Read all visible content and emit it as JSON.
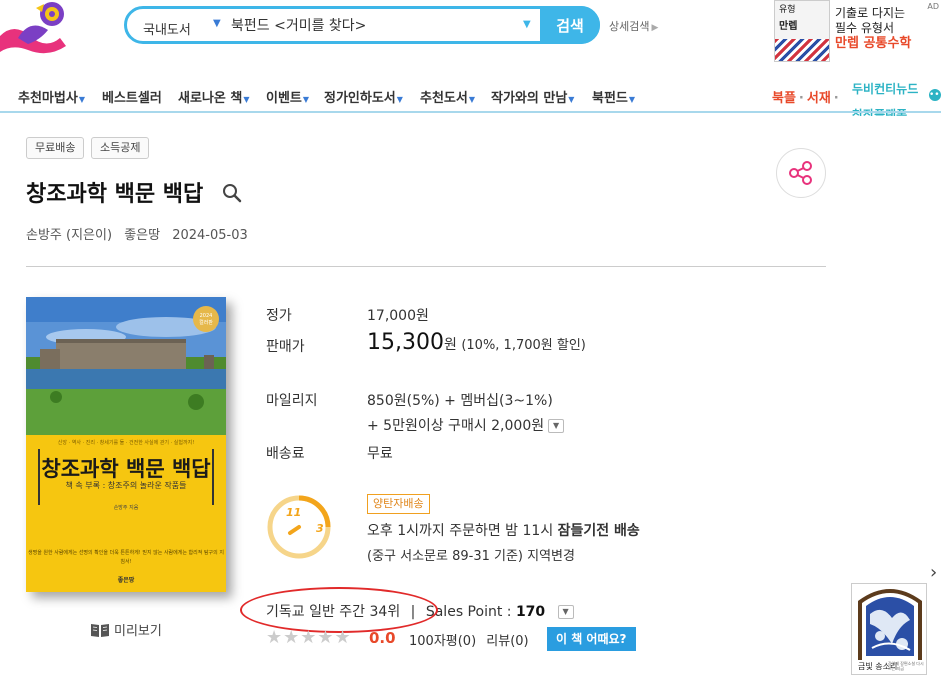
{
  "header": {
    "search_category": "국내도서",
    "search_query": "북펀드 <거미를 찾다>",
    "search_button": "검색",
    "advanced_search": "상세검색"
  },
  "ad": {
    "book_line1": "유형",
    "book_line2": "만렙",
    "line1": "기출로 다지는",
    "line2": "필수 유형서",
    "line3": "만렙 공통수학",
    "badge": "AD"
  },
  "nav": {
    "items": [
      "추천마법사",
      "베스트셀러",
      "새로나온 책",
      "이벤트",
      "정가인하도서",
      "추천도서",
      "작가와의 만남",
      "북펀드"
    ],
    "right_items": [
      "북플",
      "서재"
    ],
    "ticker": [
      "두비컨티뉴드",
      "창작플랫폼"
    ]
  },
  "product": {
    "tags": [
      "무료배송",
      "소득공제"
    ],
    "title": "창조과학 백문 백답",
    "author": "손방주 (지은이)",
    "publisher": "좋은땅",
    "date": "2024-05-03"
  },
  "cover": {
    "badge_year": "2024",
    "badge_text": "컬러판",
    "slogan": "신앙 · 역사 · 진리 · 창세기를 둘 · 건전한 사실에 관기 · 실험까지!",
    "title": "창조과학 백문 백답",
    "subtitle": "책 속 부록 : 창조주의 놀라운 작품들",
    "author": "손방주 지음",
    "blurb": "생명을 원한 사람에게는 선명의 확인을 더욱 튼튼하게! 믿지 않는 사람에게는 합리적 탐구의 지침서!",
    "publisher": "좋은땅",
    "preview_label": "미리보기"
  },
  "price": {
    "list_label": "정가",
    "list_value": "17,000원",
    "sale_label": "판매가",
    "sale_value": "15,300",
    "sale_unit": "원",
    "sale_discount": "(10%, 1,700원 할인)",
    "mileage_label": "마일리지",
    "mileage_value": "850원(5%) + 멤버십(3~1%)",
    "mileage_extra": "+ 5만원이상 구매시 2,000원",
    "shipping_label": "배송료",
    "shipping_value": "무료"
  },
  "delivery": {
    "badge": "양탄자배송",
    "clock_left": "11",
    "clock_right": "3",
    "line1_prefix": "오후 1시까지 주문하면 밤 11시 ",
    "line1_bold": "잠들기전 배송",
    "line2": "(중구 서소문로 89-31 기준) 지역변경"
  },
  "rank": {
    "text": "기독교 일반 주간 34위",
    "sep": "|",
    "sales_label": "Sales Point : ",
    "sales_value": "170"
  },
  "review": {
    "stars": "★★★★★",
    "rating": "0.0",
    "count_text": "100자평(0)",
    "review_text": "리뷰(0)",
    "how_button": "이 책 어때요?"
  },
  "side_ad": {
    "label": "금빛 송소리",
    "sub": "강영제 장편소설 다시 쓰는 지금"
  }
}
